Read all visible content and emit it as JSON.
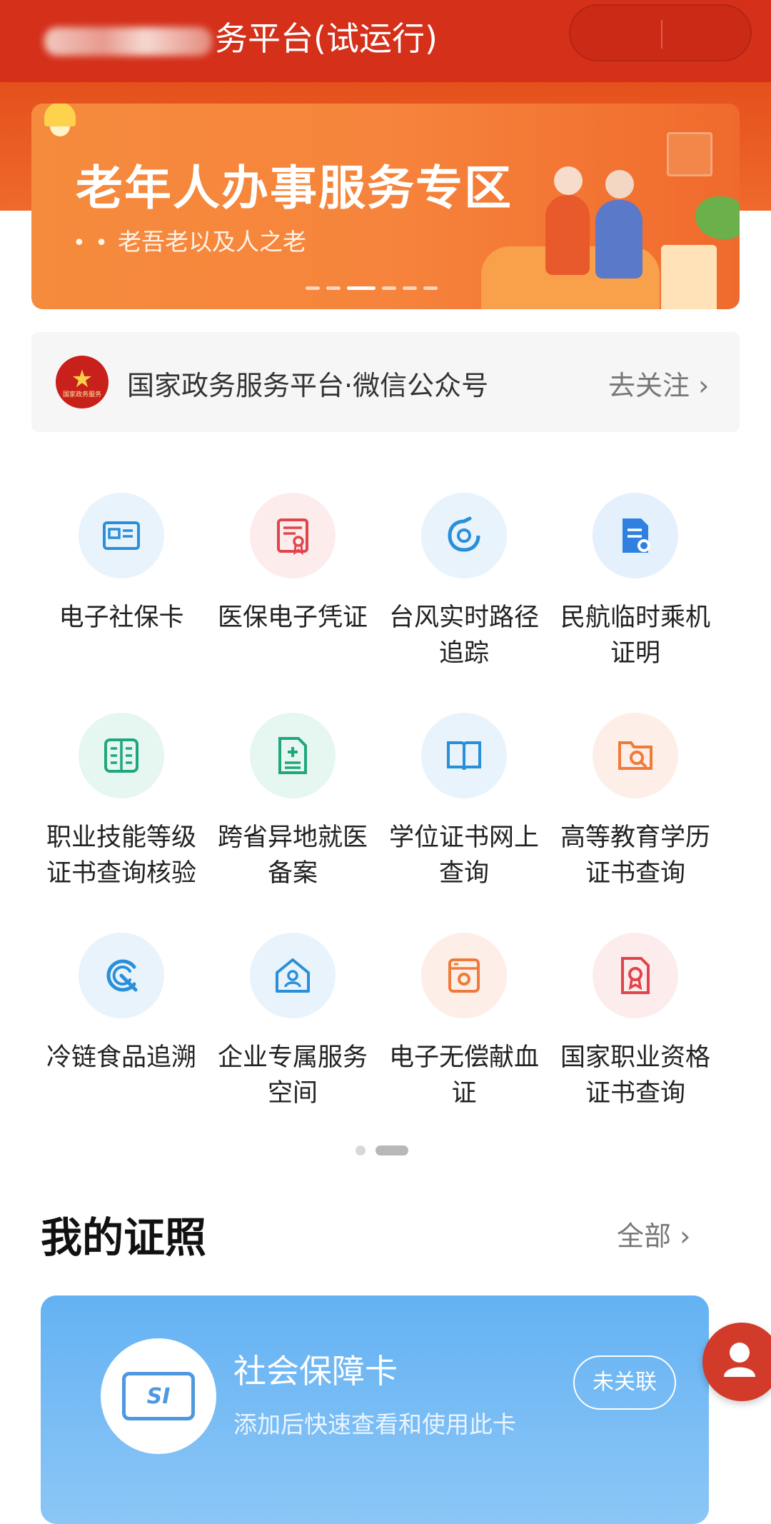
{
  "header": {
    "title_visible": "务平台(试运行)"
  },
  "banner": {
    "title": "老年人办事服务专区",
    "subtitle": "老吾老以及人之老",
    "dots": "• •"
  },
  "follow": {
    "title": "国家政务服务平台·微信公众号",
    "action": "去关注 ›",
    "emblem_text": "国家政务服务"
  },
  "services": [
    {
      "label": "电子社保卡",
      "icon": "id-card-icon",
      "color": "#2a8fd9"
    },
    {
      "label": "医保电子凭证",
      "icon": "certificate-icon",
      "color": "#e0454d"
    },
    {
      "label": "台风实时路径追踪",
      "icon": "typhoon-icon",
      "color": "#2a8fd9"
    },
    {
      "label": "民航临时乘机证明",
      "icon": "document-icon",
      "color": "#2f80e0"
    },
    {
      "label": "职业技能等级证书查询核验",
      "icon": "book-list-icon",
      "color": "#21a77e"
    },
    {
      "label": "跨省异地就医备案",
      "icon": "medical-record-icon",
      "color": "#21a77e"
    },
    {
      "label": "学位证书网上查询",
      "icon": "open-book-icon",
      "color": "#2a8fd9"
    },
    {
      "label": "高等教育学历证书查询",
      "icon": "folder-search-icon",
      "color": "#f07a3a"
    },
    {
      "label": "冷链食品追溯",
      "icon": "trace-icon",
      "color": "#2a8fd9"
    },
    {
      "label": "企业专属服务空间",
      "icon": "company-home-icon",
      "color": "#2a8fd9"
    },
    {
      "label": "电子无偿献血证",
      "icon": "blood-card-icon",
      "color": "#f07a3a"
    },
    {
      "label": "国家职业资格证书查询",
      "icon": "qualification-icon",
      "color": "#e0454d"
    }
  ],
  "my_certs": {
    "title": "我的证照",
    "all_label": "全部 ›"
  },
  "card": {
    "title": "社会保障卡",
    "subtitle": "添加后快速查看和使用此卡",
    "action": "未关联",
    "logo_text": "SI"
  }
}
